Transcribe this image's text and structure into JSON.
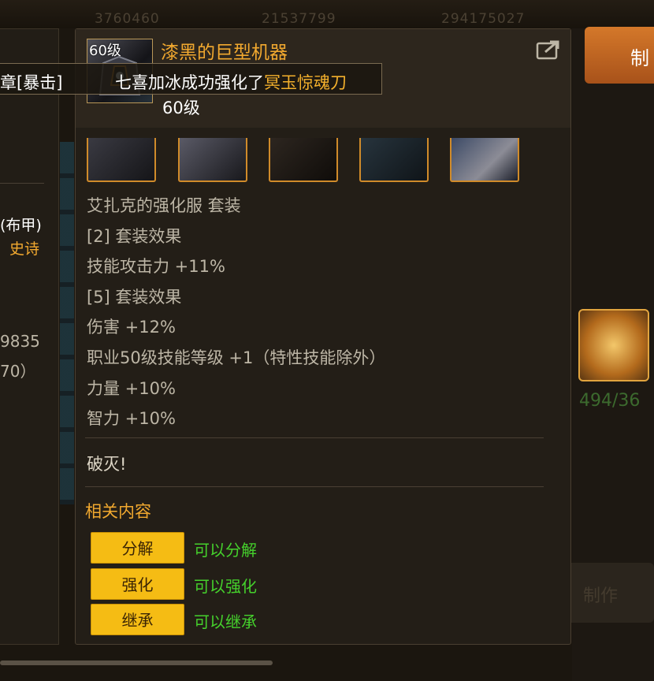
{
  "background": {
    "currency": [
      "3760460",
      "21537799",
      "294175027"
    ],
    "left_panel": {
      "armor_type": "(布甲)",
      "rarity": "史诗",
      "stat_a": "9835",
      "stat_b": "70）"
    },
    "right_panel": {
      "make_label": "制",
      "item_count": "494/36",
      "button_label": "制作"
    }
  },
  "notice": {
    "left_text": "章[暴击]",
    "message": "七喜加冰成功强化了",
    "item": "冥玉惊魂刀"
  },
  "tooltip": {
    "level_badge": "60级",
    "name": "漆黑的巨型机器",
    "level": "60级",
    "set_name": "艾扎克的强化服  套装",
    "set_effects": [
      {
        "title": "[2] 套装效果",
        "lines": [
          "技能攻击力 +11%"
        ]
      },
      {
        "title": "[5] 套装效果",
        "lines": [
          "伤害 +12%",
          "职业50级技能等级 +1（特性技能除外）",
          "力量 +10%",
          "智力 +10%"
        ]
      }
    ],
    "flavor": "破灭!",
    "related_title": "相关内容",
    "actions": [
      {
        "label": "分解",
        "desc": "可以分解"
      },
      {
        "label": "强化",
        "desc": "可以强化"
      },
      {
        "label": "继承",
        "desc": "可以继承"
      }
    ]
  },
  "colors": {
    "accent_orange": "#f2a92f",
    "button_yellow": "#f5bc14",
    "positive_green": "#45d12c"
  }
}
